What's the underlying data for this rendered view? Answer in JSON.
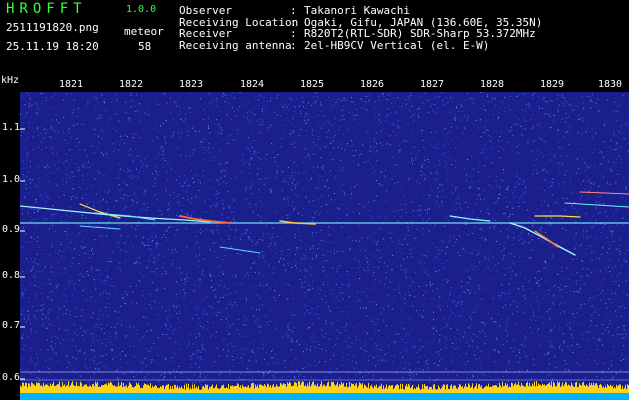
{
  "header": {
    "app_title": "HROFFT",
    "version": "1.0.0",
    "filename": "2511191820.png",
    "datetime": "25.11.19 18:20",
    "meteor_label": "meteor",
    "meteor_count": "58"
  },
  "info": [
    {
      "key": "Observer",
      "sep": ":",
      "value": "Takanori Kawachi"
    },
    {
      "key": "Receiving Location",
      "sep": ":",
      "value": "Ogaki, Gifu, JAPAN (136.60E, 35.35N)"
    },
    {
      "key": "Receiver",
      "sep": ":",
      "value": "R820T2(RTL-SDR) SDR-Sharp 53.372MHz"
    },
    {
      "key": "Receiving antenna",
      "sep": ":",
      "value": "2el-HB9CV Vertical (el. E-W)"
    }
  ],
  "axis": {
    "unit_label": "kHz",
    "time_ticks": [
      "1821",
      "1822",
      "1823",
      "1824",
      "1825",
      "1826",
      "1827",
      "1828",
      "1829",
      "1830"
    ],
    "freq_ticks": [
      "1.1",
      "1.0",
      "0.9",
      "0.8",
      "0.7",
      "0.6"
    ]
  },
  "colors": {
    "text_green": "#39ff3a",
    "background": "#000000",
    "spectrogram_bg": "#1a1f8c",
    "signal_line": "#7cf0ff",
    "histogram": "#ffd21a",
    "baseline": "#00b4ff"
  }
}
